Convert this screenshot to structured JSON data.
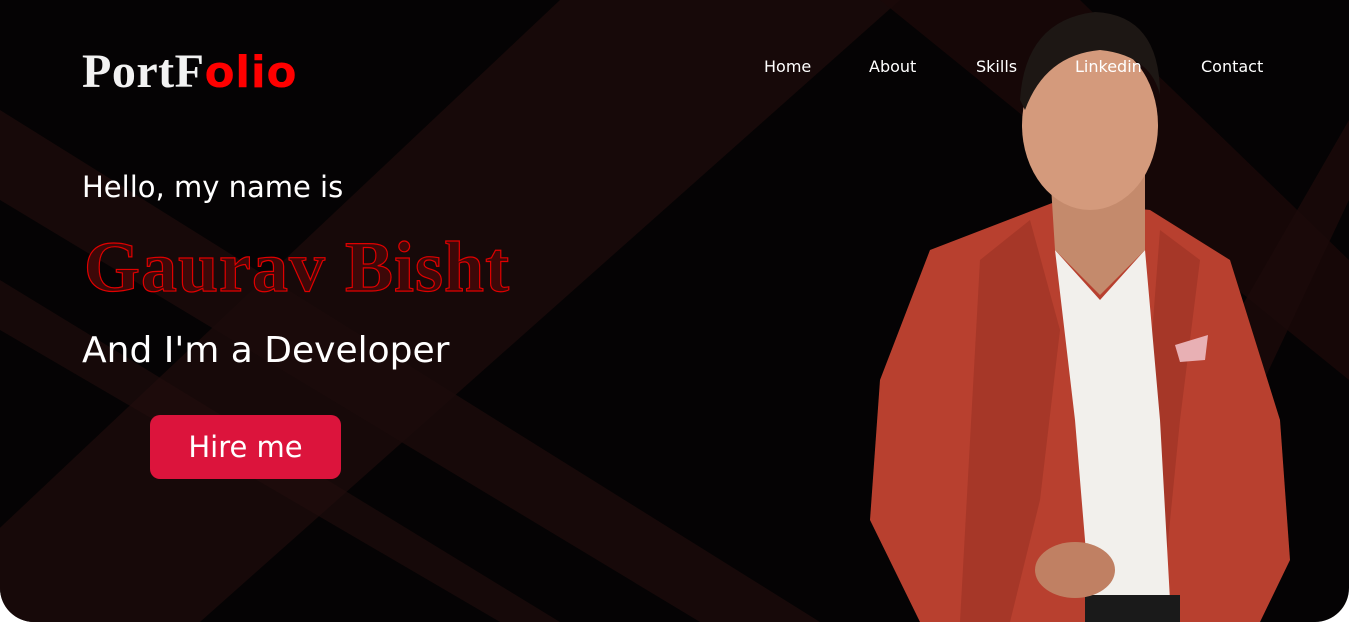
{
  "logo": {
    "part1": "PortF",
    "part2": "olio"
  },
  "nav": [
    {
      "label": "Home"
    },
    {
      "label": "About"
    },
    {
      "label": "Skills"
    },
    {
      "label": "Linkedin"
    },
    {
      "label": "Contact"
    }
  ],
  "hero": {
    "greeting": "Hello, my name is",
    "name": "Gaurav Bisht",
    "role": "And I'm a Developer",
    "cta": "Hire me"
  },
  "colors": {
    "accent": "#ff0000",
    "button": "#dc143c",
    "background": "#050304"
  },
  "icons": {
    "photo": "profile-photo"
  }
}
